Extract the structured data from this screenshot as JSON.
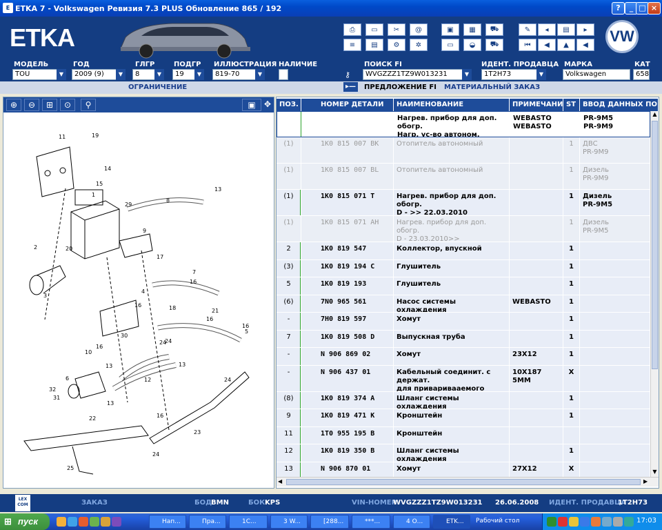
{
  "window": {
    "title": "ETKA 7 - Volkswagen Ревизия 7.3 PLUS Обновление 865 / 192",
    "btn_help": "?",
    "btn_min": "_",
    "btn_max": "□",
    "btn_close": "×"
  },
  "header": {
    "logo": "ETKA",
    "brand_badge": "VW"
  },
  "selectors": {
    "model": {
      "label": "МОДЕЛЬ",
      "value": "TOU"
    },
    "year": {
      "label": "ГОД",
      "value": "2009 (9)"
    },
    "group": {
      "label": "ГЛГР",
      "value": "8"
    },
    "subgroup": {
      "label": "ПОДГР",
      "value": "19"
    },
    "illustration": {
      "label": "ИЛЛЮСТРАЦИЯ",
      "value": "819-70"
    },
    "availability": {
      "label": "НАЛИЧИЕ"
    },
    "search_fi": {
      "label": "ПОИСК FI",
      "value": "WVGZZZ1TZ9W013231"
    },
    "dealer_id": {
      "label": "ИДЕНТ. ПРОДАВЦА",
      "value": "1T2H73"
    },
    "brand": {
      "label": "МАРКА",
      "value": "Volkswagen"
    },
    "cat": {
      "label": "КАТ",
      "value": "658"
    }
  },
  "links": {
    "restriction": "ОГРАНИЧЕНИЕ",
    "fi_offer": "ПРЕДЛОЖЕНИЕ FI",
    "material_order": "МАТЕРИАЛЬНЫЙ ЗАКАЗ"
  },
  "table": {
    "headers": {
      "pos": "ПОЗ.",
      "part_no": "НОМЕР ДЕТАЛИ",
      "name": "НАИМЕНОВАНИЕ",
      "note": "ПРИМЕЧАНИЕ",
      "st": "ST",
      "data": "ВВОД ДАННЫХ ПО"
    },
    "rows": [
      {
        "pos": "",
        "part_no": "",
        "name": "Нагрев. прибор для доп. обогр.\nНагр. ус-во автоном. отттителя",
        "note": "WEBASTO\nWEBASTO",
        "st": "",
        "data": "PR-9M5\nPR-9M9",
        "style": "hi"
      },
      {
        "pos": "(1)",
        "part_no": "1K0 815 007 BK",
        "name": "Отопитель автономный",
        "note": "",
        "st": "1",
        "data": "ДВС\nPR-9M9",
        "style": "dim"
      },
      {
        "pos": "(1)",
        "part_no": "1K0 815 007 BL",
        "name": "Отопитель автономный",
        "note": "",
        "st": "1",
        "data": "Дизель\nPR-9M9",
        "style": "dim"
      },
      {
        "pos": "(1)",
        "part_no": "1K0 815 071 T",
        "name": "Нагрев. прибор для доп. обогр.\nD -            >>  22.03.2010",
        "note": "",
        "st": "1",
        "data": "Дизель\nPR-9M5",
        "style": "green"
      },
      {
        "pos": "(1)",
        "part_no": "1K0 815 071 AH",
        "name": "Нагрев. прибор для доп. обогр.\nD - 23.03.2010>>",
        "note": "",
        "st": "1",
        "data": "Дизель\nPR-9M5",
        "style": "dim"
      },
      {
        "pos": "2",
        "part_no": "1K0 819 547",
        "name": "Коллектор, впускной",
        "note": "",
        "st": "1",
        "data": "",
        "style": "green"
      },
      {
        "pos": "(3)",
        "part_no": "1K0 819 194 C",
        "name": "Глушитель",
        "note": "",
        "st": "1",
        "data": "",
        "style": "green"
      },
      {
        "pos": "5",
        "part_no": "1K0 819 193",
        "name": "Глушитель",
        "note": "",
        "st": "1",
        "data": "",
        "style": "green"
      },
      {
        "pos": "(6)",
        "part_no": "7N0 965 561",
        "name": "Насос системы охлаждения",
        "note": "WEBASTO",
        "st": "1",
        "data": "",
        "style": "green"
      },
      {
        "pos": "-",
        "part_no": "7H0 819 597",
        "name": "Хомут",
        "note": "",
        "st": "1",
        "data": "",
        "style": "green"
      },
      {
        "pos": "7",
        "part_no": "1K0 819 508 D",
        "name": "Выпускная труба",
        "note": "",
        "st": "1",
        "data": "",
        "style": "green"
      },
      {
        "pos": "-",
        "part_no": "N   906 869 02",
        "name": "Хомут",
        "note": "23X12",
        "st": "1",
        "data": "",
        "style": "green"
      },
      {
        "pos": "-",
        "part_no": "N   906 437 01",
        "name": "Кабельный соединит. с держат.\nдля приваривааемого штифта",
        "note": "10X187\n5MM",
        "st": "X",
        "data": "",
        "style": "green"
      },
      {
        "pos": "(8)",
        "part_no": "1K0 819 374 A",
        "name": "Шланг системы охлаждения",
        "note": "",
        "st": "1",
        "data": "",
        "style": "green"
      },
      {
        "pos": "9",
        "part_no": "1K0 819 471 K",
        "name": "Кронштейн",
        "note": "",
        "st": "1",
        "data": "",
        "style": "green"
      },
      {
        "pos": "11",
        "part_no": "1T0 955 195 B",
        "name": "Кронштейн",
        "note": "",
        "st": "",
        "data": "",
        "style": "green"
      },
      {
        "pos": "12",
        "part_no": "1K0 819 350 B",
        "name": "Шланг системы охлаждения",
        "note": "",
        "st": "1",
        "data": "",
        "style": "green"
      },
      {
        "pos": "13",
        "part_no": "N   906 870 01",
        "name": "Хомут",
        "note": "27X12",
        "st": "X",
        "data": "",
        "style": "green"
      }
    ]
  },
  "status": {
    "order": "ЗАКАЗ",
    "bod_label": "БОД",
    "bod_value": "BMN",
    "bok_label": "БОК",
    "bok_value": "KPS",
    "vin_label": "VIN-НОМЕР",
    "vin_value": "WVGZZZ1TZ9W013231",
    "date": "26.06.2008",
    "dealer_label": "ИДЕНТ. ПРОДАВЦА",
    "dealer_value": "1T2H73",
    "lexcom": "LEX\nCOM"
  },
  "taskbar": {
    "start": "пуск",
    "tasks": [
      "Нап...",
      "Пра...",
      "1С...",
      "3 W...",
      "[288...",
      "***...",
      "4 О...",
      "ETK...",
      "Рабочий стол"
    ],
    "clock": "17:03"
  },
  "diagram_labels": [
    "19",
    "11",
    "14",
    "15",
    "1",
    "29",
    "8",
    "13",
    "9",
    "2",
    "20",
    "17",
    "3",
    "7",
    "16",
    "21",
    "16",
    "4",
    "16",
    "24",
    "18",
    "10",
    "16",
    "30",
    "24",
    "13",
    "12",
    "6",
    "13",
    "32",
    "31",
    "13",
    "24",
    "22",
    "16",
    "23",
    "24",
    "25",
    "5"
  ],
  "colors": {
    "brand_blue": "#143D82",
    "table_row": "#E8EDF7",
    "green_bar": "#2AA22A"
  }
}
